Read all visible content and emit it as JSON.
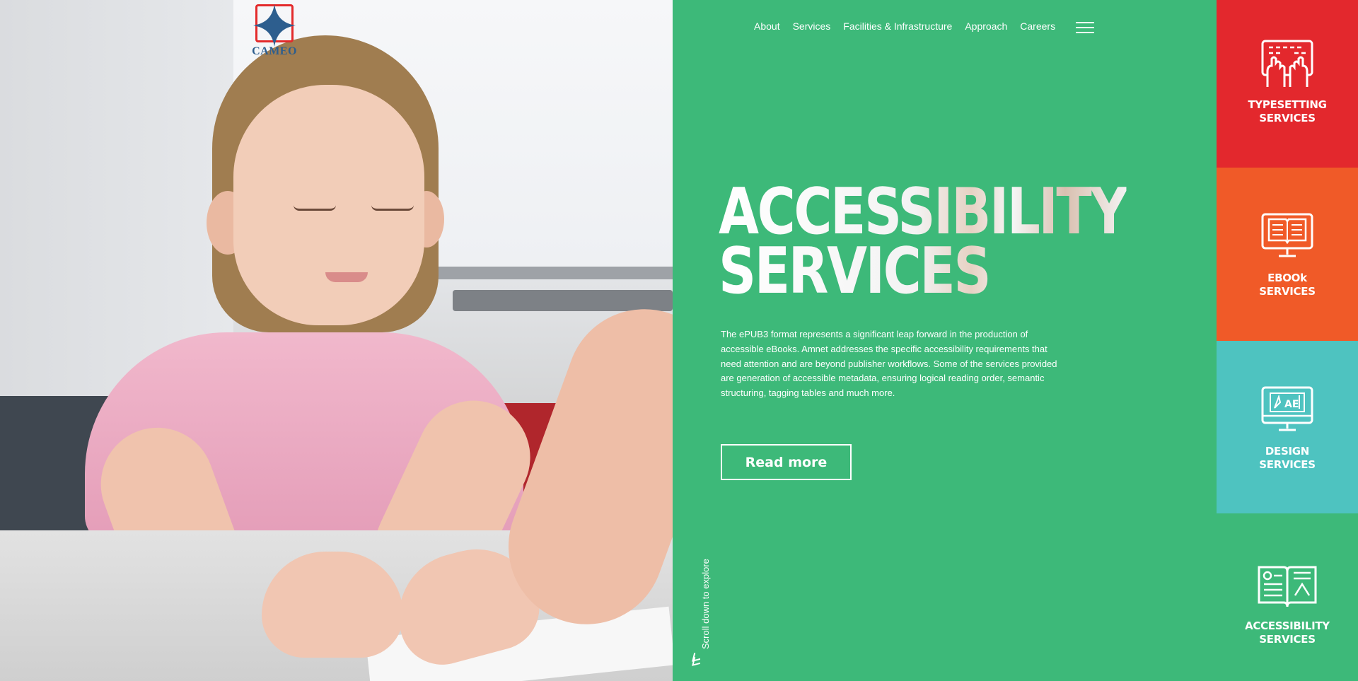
{
  "brand": {
    "logo_text": "CAMEO",
    "colors": {
      "green": "#3db979",
      "red": "#e3282d",
      "orange": "#f05a28",
      "teal": "#4ec3c0",
      "logo_blue": "#2d5e8e",
      "logo_red": "#e32a2b"
    }
  },
  "nav": {
    "items": [
      "About",
      "Services",
      "Facilities & Infrastructure",
      "Approach",
      "Careers"
    ],
    "menu_icon": "hamburger-icon"
  },
  "hero": {
    "title_line1": "ACCESSIBILITY",
    "title_line2": "SERVICES",
    "description": "The ePUB3 format represents a significant leap forward in the production of accessible eBooks. Amnet addresses the specific accessibility requirements that need attention and are beyond publisher workflows. Some of the services provided are generation of accessible metadata, ensuring logical reading order, semantic structuring, tagging tables and much more.",
    "cta_label": "Read more",
    "scroll_hint": "Scroll down to explore"
  },
  "services": [
    {
      "line1": "TYPESETTING",
      "line2": "SERVICES",
      "icon": "typing-hands-icon"
    },
    {
      "line1": "EBOOk",
      "line2": "SERVICES",
      "icon": "ebook-monitor-icon"
    },
    {
      "line1": "DESIGN",
      "line2": "SERVICES",
      "icon": "design-monitor-icon"
    },
    {
      "line1": "ACCESSIBILITY",
      "line2": "SERVICES",
      "icon": "open-book-icon"
    }
  ],
  "photo": {
    "description_icon": "photo"
  }
}
